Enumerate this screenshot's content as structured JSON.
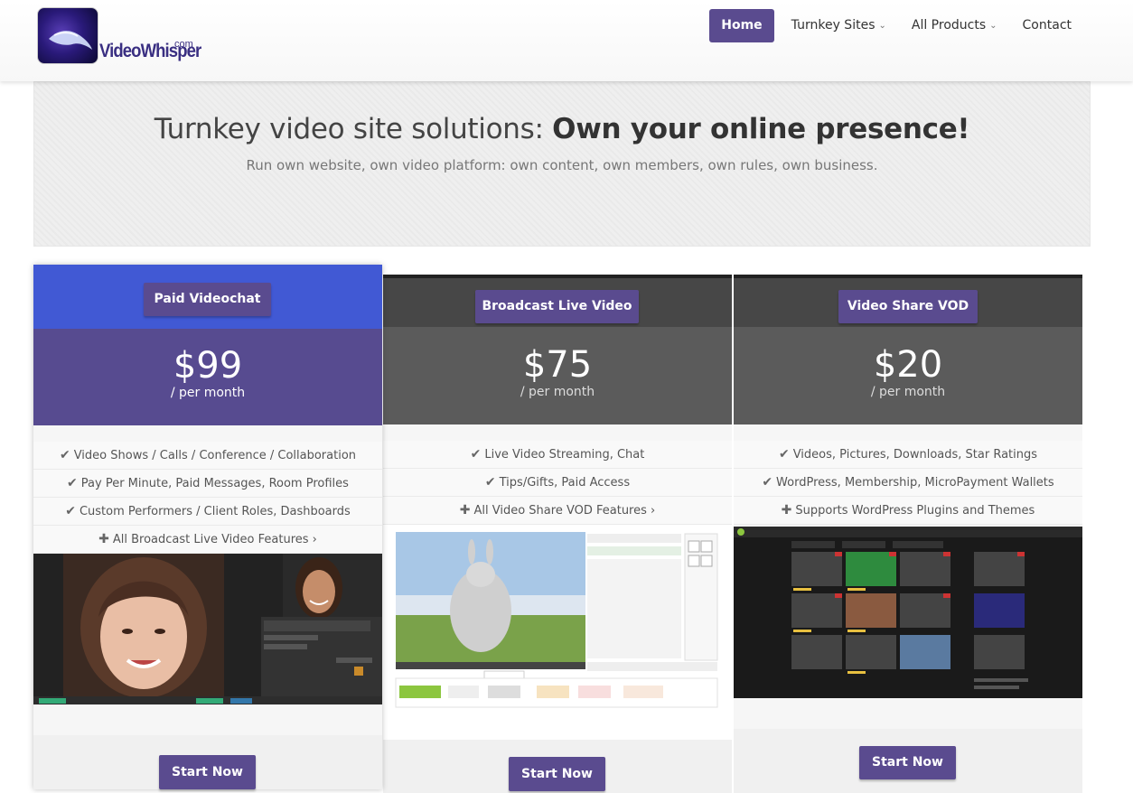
{
  "header": {
    "logo_text": "VideoWhisper",
    "logo_com": "com",
    "nav": [
      {
        "label": "Home",
        "active": true
      },
      {
        "label": "Turnkey Sites",
        "dropdown": true
      },
      {
        "label": "All Products",
        "dropdown": true
      },
      {
        "label": "Contact"
      }
    ]
  },
  "hero": {
    "title_light": "Turnkey video site solutions: ",
    "title_bold": "Own your online presence!",
    "subtitle": "Run own website, own video platform: own content, own members, own rules, own business."
  },
  "plans": [
    {
      "name": "Paid Videochat",
      "price": "$99",
      "period": "/ per month",
      "features": [
        {
          "icon": "check",
          "text": "Video Shows / Calls / Conference / Collaboration"
        },
        {
          "icon": "check",
          "text": "Pay Per Minute, Paid Messages, Room Profiles"
        },
        {
          "icon": "check",
          "text": "Custom Performers / Client Roles, Dashboards"
        },
        {
          "icon": "plus",
          "text": "All Broadcast Live Video Features ›"
        }
      ],
      "cta": "Start Now",
      "top_color": "#4159d4",
      "band_color": "#574b90"
    },
    {
      "name": "Broadcast Live Video",
      "price": "$75",
      "period": "/ per month",
      "features": [
        {
          "icon": "check",
          "text": "Live Video Streaming, Chat"
        },
        {
          "icon": "check",
          "text": "Tips/Gifts, Paid Access"
        },
        {
          "icon": "plus",
          "text": "All Video Share VOD Features ›"
        }
      ],
      "cta": "Start Now",
      "top_color": "#474747",
      "band_color": "#5b5b5b"
    },
    {
      "name": "Video Share VOD",
      "price": "$20",
      "period": "/ per month",
      "features": [
        {
          "icon": "check",
          "text": "Videos, Pictures, Downloads, Star Ratings"
        },
        {
          "icon": "check",
          "text": "WordPress, Membership, MicroPayment Wallets"
        },
        {
          "icon": "plus",
          "text": "Supports WordPress Plugins and Themes"
        }
      ],
      "cta": "Start Now",
      "top_color": "#474747",
      "band_color": "#5b5b5b"
    }
  ],
  "icons": {
    "check": "check-icon",
    "plus": "plus-icon",
    "chevron": "chevron-down-icon"
  }
}
